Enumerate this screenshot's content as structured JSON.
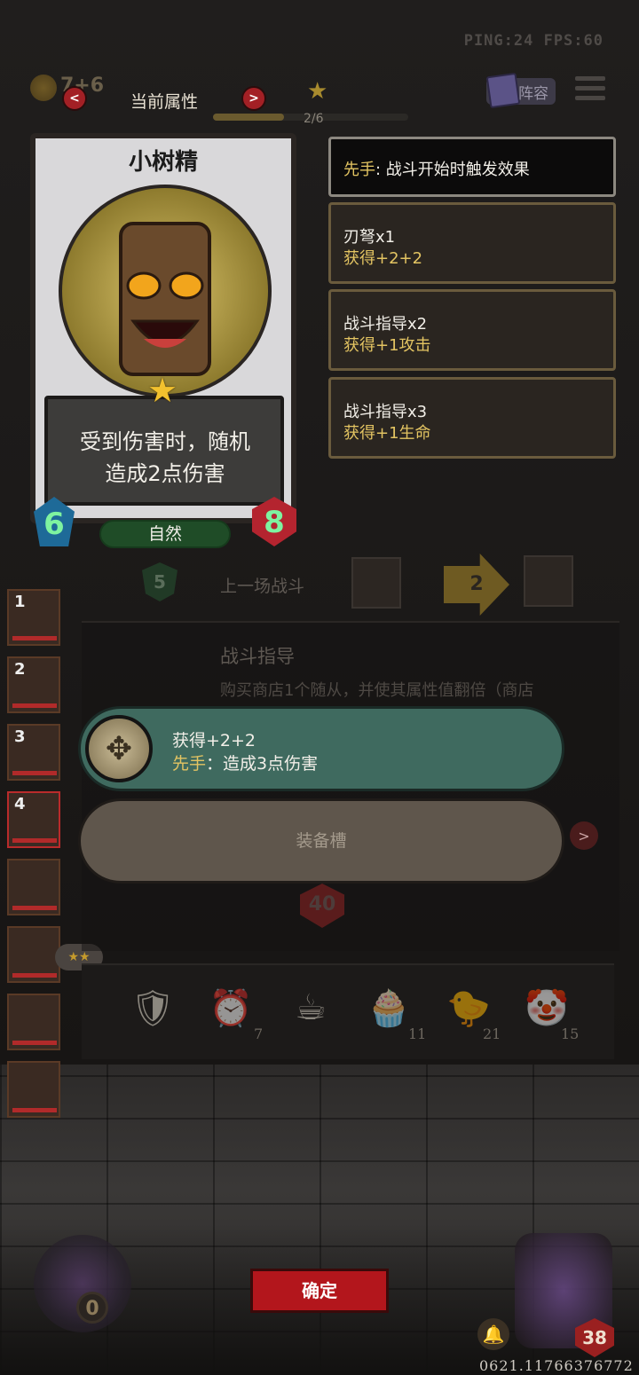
{
  "status": {
    "net": "PING:24   FPS:60",
    "gold": "7+6"
  },
  "header": {
    "tab_label": "当前属性",
    "prev_arrow": "<",
    "next_arrow": ">",
    "page_indicator": "2/6",
    "lineup_label": "阵容"
  },
  "card": {
    "name": "小树精",
    "ability_line1": "受到伤害时，随机",
    "ability_line2": "造成2点伤害",
    "tribe": "自然",
    "attack": "6",
    "health": "8"
  },
  "info_boxes": [
    {
      "keyword": "先手",
      "text": ": 战斗开始时触发效果"
    },
    {
      "line1": "刃弩x1",
      "line2": "获得+2+2"
    },
    {
      "line1": "战斗指导x2",
      "line2": "获得+1攻击"
    },
    {
      "line1": "战斗指导x3",
      "line2": "获得+1生命"
    }
  ],
  "left_slots": [
    "1",
    "2",
    "3",
    "4"
  ],
  "battle": {
    "shield_value": "5",
    "last_battle_label": "上一场战斗",
    "arrow_value": "2",
    "guide_title": "战斗指导",
    "guide_desc": "购买商店1个随从，并使其属性值翻倍（商店"
  },
  "equipment": {
    "line1": "获得+2+2",
    "keyword": "先手",
    "line2_rest": "：造成3点伤害",
    "slot_label": "装备槽",
    "next_arrow": ">"
  },
  "hp_badge": "40",
  "toolbar": {
    "items": [
      {
        "icon": "shield-icon",
        "count": ""
      },
      {
        "icon": "alarm-clock-icon",
        "count": "7"
      },
      {
        "icon": "teacup-icon",
        "count": ""
      },
      {
        "icon": "cupcake-icon",
        "count": "11"
      },
      {
        "icon": "duck-icon",
        "count": "21"
      },
      {
        "icon": "clown-icon",
        "count": "15"
      }
    ]
  },
  "footer": {
    "confirm": "确定",
    "orb_count": "0",
    "hero_hp": "38",
    "uid": "0621.11766376772"
  }
}
